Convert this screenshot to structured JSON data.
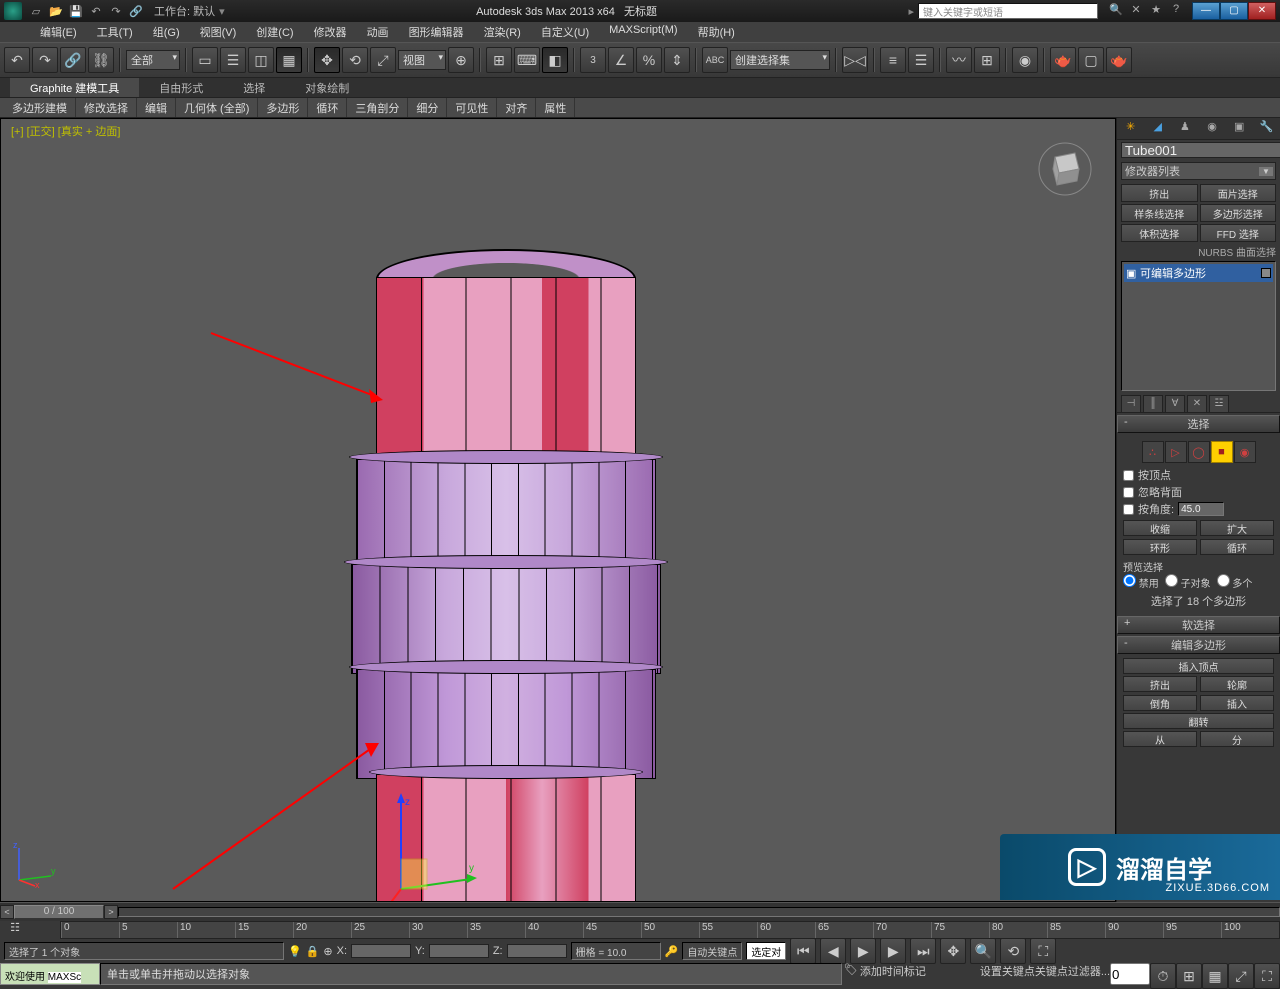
{
  "title": {
    "workspace_label": "工作台: 默认",
    "app": "Autodesk 3ds Max  2013 x64",
    "doc": "无标题",
    "search_placeholder": "键入关键字或短语"
  },
  "menus": [
    "编辑(E)",
    "工具(T)",
    "组(G)",
    "视图(V)",
    "创建(C)",
    "修改器",
    "动画",
    "图形编辑器",
    "渲染(R)",
    "自定义(U)",
    "MAXScript(M)",
    "帮助(H)"
  ],
  "toolbar": {
    "selset_drop": "全部",
    "view_drop": "视图",
    "named_sel": "创建选择集"
  },
  "ribbon": {
    "tabs": [
      "Graphite 建模工具",
      "自由形式",
      "选择",
      "对象绘制"
    ],
    "sub": [
      "多边形建模",
      "修改选择",
      "编辑",
      "几何体 (全部)",
      "多边形",
      "循环",
      "三角剖分",
      "细分",
      "可见性",
      "对齐",
      "属性"
    ]
  },
  "viewport": {
    "label": "[+] [正交] [真实 + 边面]"
  },
  "panel": {
    "obj_name": "Tube001",
    "mod_list_label": "修改器列表",
    "mod_buttons": [
      "挤出",
      "面片选择",
      "样条线选择",
      "多边形选择",
      "体积选择",
      "FFD 选择"
    ],
    "nurbs_text": "NURBS 曲面选择",
    "stack_item": "可编辑多边形",
    "rollouts": {
      "selection": "选择",
      "by_vertex": "按顶点",
      "ignore_back": "忽略背面",
      "by_angle": "按角度:",
      "angle_val": "45.0",
      "shrink": "收缩",
      "grow": "扩大",
      "ring": "环形",
      "loop": "循环",
      "preview_sel": "预览选择",
      "radio": [
        "禁用",
        "子对象",
        "多个"
      ],
      "sel_count": "选择了 18 个多边形",
      "soft_sel": "软选择",
      "edit_poly": "编辑多边形",
      "insert_vert": "插入顶点",
      "extrude": "挤出",
      "outline": "轮廓",
      "bevel": "倒角",
      "insert": "插入",
      "flip": "翻转",
      "from": "从",
      "hinge": "分"
    }
  },
  "time": {
    "slider": "0 / 100",
    "ticks": [
      "0",
      "5",
      "10",
      "15",
      "20",
      "25",
      "30",
      "35",
      "40",
      "45",
      "50",
      "55",
      "60",
      "65",
      "70",
      "75",
      "80",
      "85",
      "90",
      "95",
      "100"
    ]
  },
  "status": {
    "sel": "选择了 1 个对象",
    "x": "X:",
    "y": "Y:",
    "z": "Z:",
    "grid": "栅格 = 10.0",
    "autokey": "自动关键点",
    "selkey": "选定对",
    "setkey": "设置关键点",
    "keyfilter": "关键点过滤器...",
    "prompt": "单击或单击并拖动以选择对象",
    "add_tag": "添加时间标记",
    "welcome": "欢迎使用",
    "maxscr": "MAXSc"
  },
  "watermark": {
    "text": "溜溜自学",
    "url": "ZIXUE.3D66.COM"
  }
}
